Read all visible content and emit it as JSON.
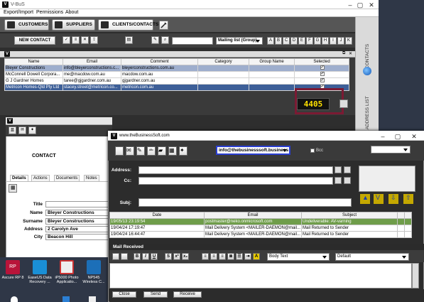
{
  "main_window": {
    "title": "V-BuS",
    "menu": [
      "Export/Import",
      "Permissions",
      "About"
    ],
    "nav_tabs": [
      "CUSTOMERS",
      "SUPPLIERS",
      "CLIENTS/CONTACTS"
    ],
    "toolbar": {
      "new_contact": "NEW CONTACT",
      "mailing_list": "Mailing list (Group)",
      "alpha_buttons": [
        "A",
        "B",
        "C",
        "D",
        "E",
        "F",
        "G",
        "H",
        "I",
        "J",
        "K"
      ]
    },
    "vertical_tabs": [
      "CONTACTS",
      "EMAIL ADDRESS LIST"
    ],
    "contacts_table": {
      "columns": [
        "Name",
        "Email",
        "Comment",
        "Category",
        "Group Name",
        "Selected"
      ],
      "rows": [
        {
          "name": "Bleyer Constructions",
          "email": "info@bleyerconstructions.c...",
          "comment": "bleyerconstructions.com.au",
          "category": "",
          "group": "",
          "selected": "✓"
        },
        {
          "name": "McConnell Dowell Corpora...",
          "email": "me@macdow.com.au",
          "comment": "macdow.com.au",
          "category": "",
          "group": "",
          "selected": "✓"
        },
        {
          "name": "G J Gardner Homes",
          "email": "taree@gjgardner.com.au",
          "comment": "gjgardner.com.au",
          "category": "",
          "group": "",
          "selected": "✓"
        },
        {
          "name": "Metricon Homes-Qld Pty Ltd",
          "email": "stacey.street@metricon.co...",
          "comment": "metricon.com.au",
          "category": "",
          "group": "",
          "selected": "✓"
        }
      ]
    },
    "record_count": "4405"
  },
  "detail_window": {
    "heading": "CONTACT",
    "tabs": [
      "Details",
      "Actions",
      "Documents",
      "Notes"
    ],
    "fields": [
      {
        "label": "Title",
        "value": ""
      },
      {
        "label": "Name",
        "value": "Bleyer Constructions"
      },
      {
        "label": "Surname",
        "value": "Bleyer Constructions"
      },
      {
        "label": "Address",
        "value": "2 Carolyn Ave"
      },
      {
        "label": "City",
        "value": "Beacon Hill"
      }
    ]
  },
  "desktop_icons": [
    {
      "label": "Ascure RP 8"
    },
    {
      "label": "EaseUS Data Recovery ..."
    },
    {
      "label": "iP5000 Photo Applicatio..."
    },
    {
      "label": "NP545 Wireless C..."
    }
  ],
  "mail_window": {
    "title": "www.theBusinessSoft.com",
    "from_account": "info@thebusinesssoft.business",
    "bcc_label": "Bcc",
    "address_label": "Address:",
    "cc_label": "Cc:",
    "subject_label": "Subj:",
    "mail_table": {
      "columns": [
        "Date",
        "Email",
        "Subject"
      ],
      "rows": [
        {
          "date": "19/05/13 23:19:54",
          "email": "postmaster@neko.onmicrosoft.com",
          "subject": "Undeliverable: AV-varning"
        },
        {
          "date": "19/04/24 17:19:47",
          "email": "Mail Delivery System <MAILER-DAEMON@mail...",
          "subject": "Mail Returned to Sender"
        },
        {
          "date": "19/04/24 16:44:47",
          "email": "Mail Delivery System <MAILER-DAEMON@mail...",
          "subject": "Mail Returned to Sender"
        }
      ]
    },
    "mail_received": "Mail Received",
    "body_style": "Body Text",
    "font": "Default",
    "buttons": [
      "Close",
      "Send",
      "Receive"
    ]
  }
}
